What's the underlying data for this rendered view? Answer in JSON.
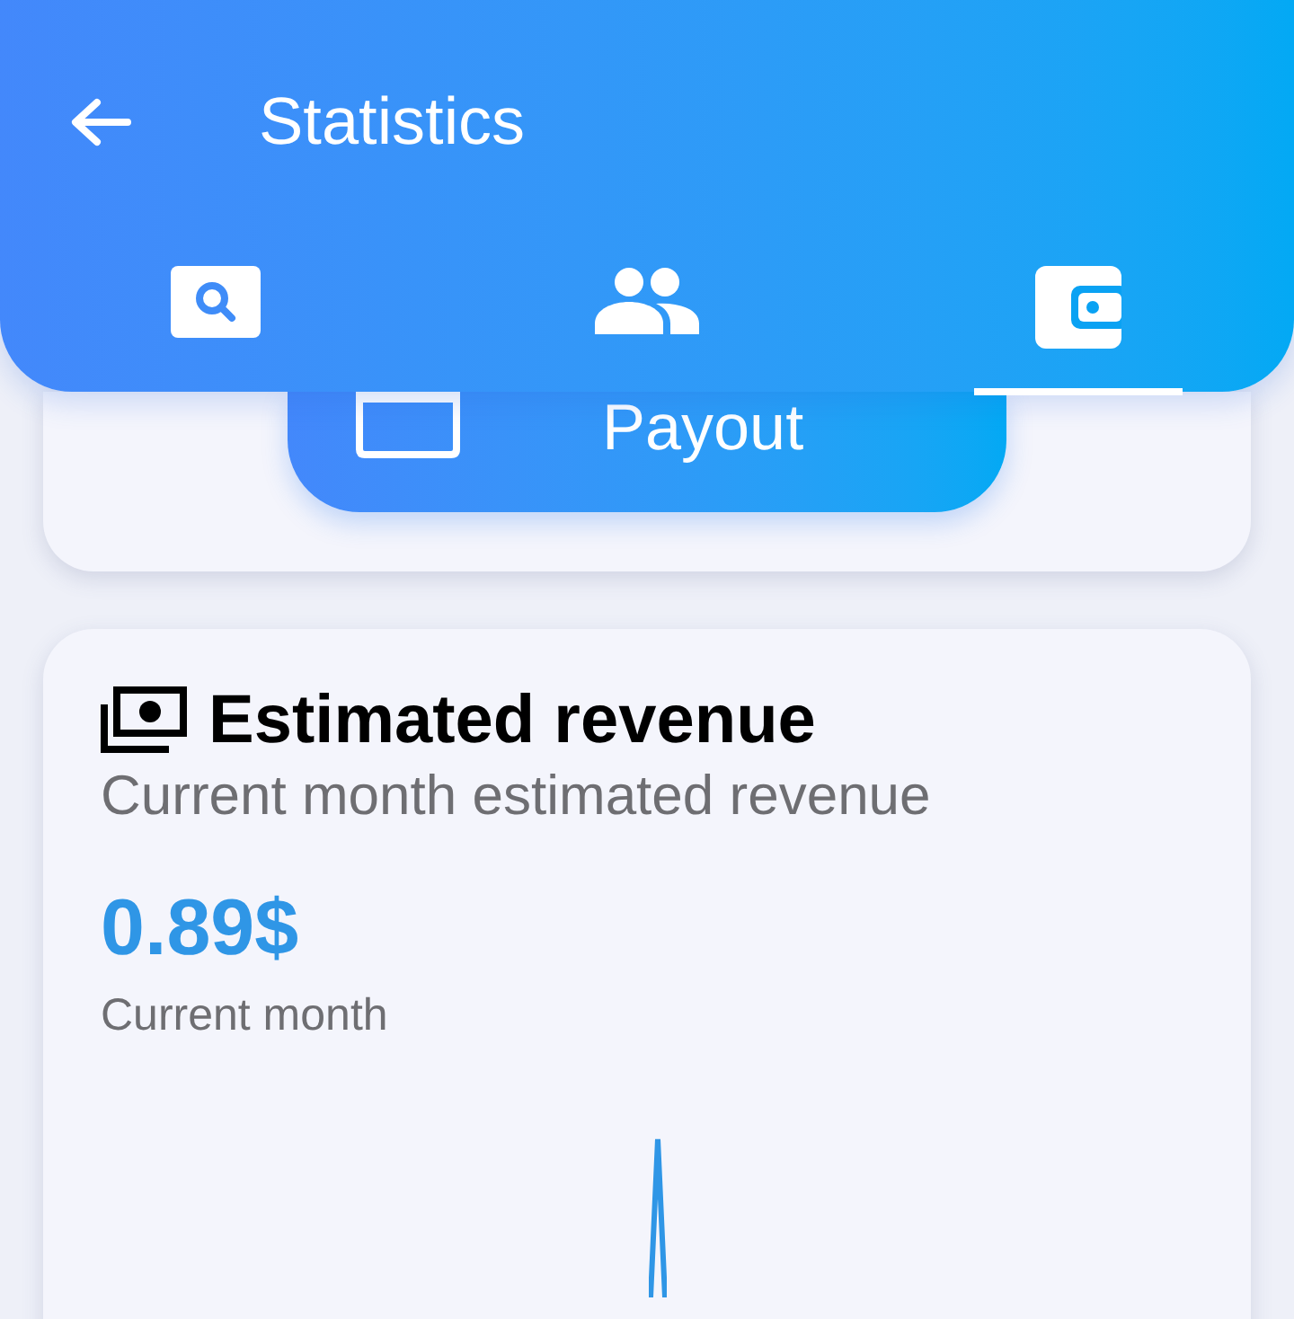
{
  "header": {
    "title": "Statistics"
  },
  "tabs": [
    {
      "kind": "search",
      "selected": false
    },
    {
      "kind": "people",
      "selected": false
    },
    {
      "kind": "wallet",
      "selected": true
    }
  ],
  "payout_button": {
    "label": "Payout"
  },
  "revenue_card": {
    "title": "Estimated revenue",
    "subtitle": "Current month estimated revenue",
    "amount": "0.89$",
    "amount_label": "Current month"
  }
}
